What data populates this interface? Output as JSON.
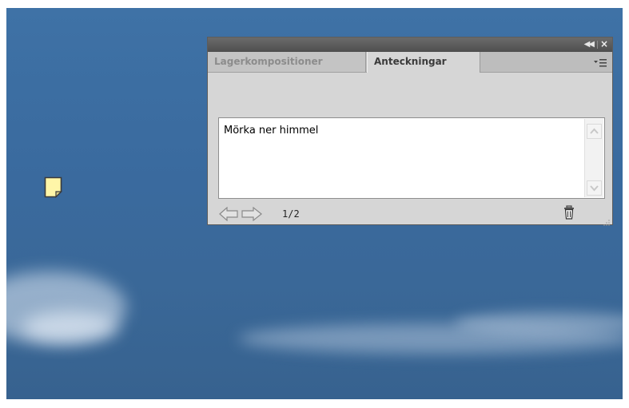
{
  "panel": {
    "tabs": [
      {
        "label": "Lagerkompositioner",
        "active": false
      },
      {
        "label": "Anteckningar",
        "active": true
      }
    ],
    "titlebar": {
      "collapse_icon": "double-chevron-left-icon",
      "close_icon": "close-icon"
    },
    "menu_icon": "panel-menu-icon",
    "note_text": "Mörka ner himmel",
    "page_indicator": "1/2",
    "nav": {
      "prev_icon": "arrow-left-icon",
      "next_icon": "arrow-right-icon"
    },
    "delete_icon": "trash-icon"
  },
  "canvas": {
    "note_marker_icon": "sticky-note-icon"
  },
  "colors": {
    "sky": "#3a6a9e",
    "panel_bg": "#d6d6d6",
    "titlebar": "#555555",
    "note_yellow": "#fff6a8"
  }
}
